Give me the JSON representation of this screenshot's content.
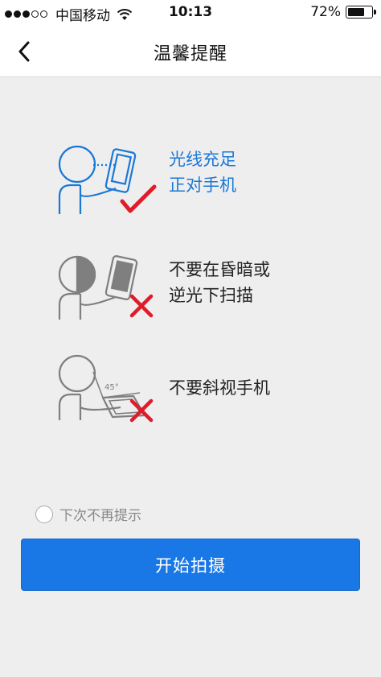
{
  "status_bar": {
    "carrier": "中国移动",
    "time": "10:13",
    "battery_text": "72%",
    "battery_level": 0.72
  },
  "nav": {
    "title": "温馨提醒"
  },
  "tips": [
    {
      "line1": "光线充足",
      "line2": "正对手机",
      "status": "ok"
    },
    {
      "line1": "不要在昏暗或",
      "line2": "逆光下扫描",
      "status": "no"
    },
    {
      "line1": "不要斜视手机",
      "line2": "",
      "status": "no",
      "angle_label": "45°"
    }
  ],
  "checkbox": {
    "label": "下次不再提示",
    "checked": false
  },
  "start_button": {
    "label": "开始拍摄"
  },
  "colors": {
    "accent": "#1a78e6",
    "ok_text": "#1a78d6",
    "cross": "#e01b2a",
    "check": "#e01b2a"
  }
}
